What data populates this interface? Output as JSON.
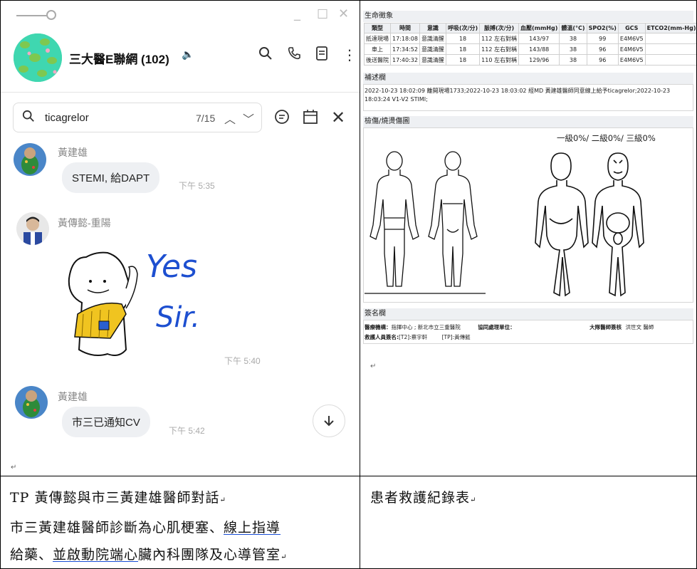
{
  "chat": {
    "group_title": "三大醫E聯網 (102)",
    "search": {
      "query": "ticagrelor",
      "count": "7/15"
    },
    "messages": [
      {
        "sender": "黃建雄",
        "text": "STEMI, 給DAPT",
        "time": "下午 5:35"
      },
      {
        "sender": "黃傳懿-重陽",
        "sticker_line1": "Yes",
        "sticker_line2": "Sir.",
        "time": "下午 5:40"
      },
      {
        "sender": "黃建雄",
        "text": "市三已通知CV",
        "time": "下午 5:42"
      }
    ]
  },
  "record": {
    "vitals_title": "生命徵象",
    "vitals_headers": [
      "類型",
      "時間",
      "意識",
      "呼吸(次/分)",
      "脈搏(次/分)",
      "血壓(mmHg)",
      "體溫(°C)",
      "SPO2(%)",
      "GCS",
      "ETCO2(mm-Hg)"
    ],
    "vitals_rows": [
      [
        "抵達現場",
        "17:18:08",
        "意識清醒",
        "18",
        "112 左右對稱",
        "143/97",
        "38",
        "99",
        "E4M6V5",
        ""
      ],
      [
        "車上",
        "17:34:52",
        "意識清醒",
        "18",
        "112 左右對稱",
        "143/88",
        "38",
        "96",
        "E4M6V5",
        ""
      ],
      [
        "後送醫院",
        "17:40:32",
        "意識清醒",
        "18",
        "110 左右對稱",
        "129/96",
        "38",
        "96",
        "E4M6V5",
        ""
      ]
    ],
    "note_title": "補述欄",
    "note_text": "2022-10-23 18:02:09 離開現場1733;2022-10-23 18:03:02 經MD 黃建雄醫師同意線上給予ticagrelor;2022-10-23 18:03:24 V1-V2 STIMI;",
    "injury_title": "檢傷/燒燙傷圖",
    "burn_text": "一級0%/ 二級0%/ 三級0%",
    "sign_title": "簽名欄",
    "sign_row1": {
      "k1": "醫療機構：",
      "v1": "指揮中心 ; 新北市立三重醫院",
      "k2": "協同處理單位：",
      "k3": "大隊醫師簽核",
      "v3": "洪世文 醫師"
    },
    "sign_row2": {
      "k1": "救護人員簽名:",
      "v1": "[T2]:蔡宇軒",
      "v2": "[TP]:黃傳懿"
    }
  },
  "captions": {
    "left_line1": "TP 黃傳懿與市三黃建雄醫師對話",
    "left_line2a": "市三黃建雄醫師診斷為心肌梗塞、",
    "left_line2b": "線上指導",
    "left_line3a": "給藥",
    "left_line3b": "、",
    "left_line3c": "並啟動院端心",
    "left_line3d": "臟內科團隊及心導管室",
    "right_line1": "患者救護紀錄表"
  }
}
